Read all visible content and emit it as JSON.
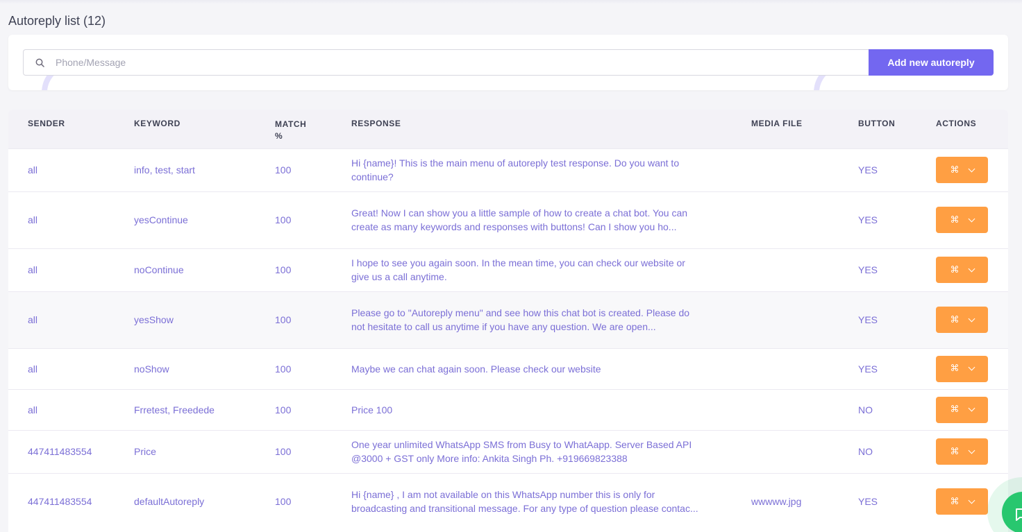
{
  "page": {
    "title": "Autoreply list (12)"
  },
  "search": {
    "placeholder": "Phone/Message",
    "value": "",
    "icon": "search-icon"
  },
  "toolbar": {
    "add_label": "Add new autoreply"
  },
  "table": {
    "headers": {
      "sender": "SENDER",
      "keyword": "KEYWORD",
      "match": "MATCH %",
      "response": "RESPONSE",
      "media": "MEDIA FILE",
      "button": "BUTTON",
      "actions": "ACTIONS"
    },
    "rows": [
      {
        "sender": "all",
        "keyword": "info, test, start",
        "match": "100",
        "response": "Hi {name}! This is the main menu of autoreply test response. Do you want to continue?",
        "media": "",
        "button": "YES"
      },
      {
        "sender": "all",
        "keyword": "yesContinue",
        "match": "100",
        "response": "Great! Now I can show you a little sample of how to create a chat bot. You can create as many keywords and responses with buttons! Can I show you ho...",
        "media": "",
        "button": "YES"
      },
      {
        "sender": "all",
        "keyword": "noContinue",
        "match": "100",
        "response": "I hope to see you again soon. In the mean time, you can check our website or give us a call anytime.",
        "media": "",
        "button": "YES"
      },
      {
        "sender": "all",
        "keyword": "yesShow",
        "match": "100",
        "response": "Please go to \"Autoreply menu\" and see how this chat bot is created. Please do not hesitate to call us anytime if you have any question. We are open...",
        "media": "",
        "button": "YES"
      },
      {
        "sender": "all",
        "keyword": "noShow",
        "match": "100",
        "response": "Maybe we can chat again soon. Please check our website",
        "media": "",
        "button": "YES"
      },
      {
        "sender": "all",
        "keyword": "Frretest, Freedede",
        "match": "100",
        "response": "Price 100",
        "media": "",
        "button": "NO"
      },
      {
        "sender": "447411483554",
        "keyword": "Price",
        "match": "100",
        "response": "One year unlimited WhatsApp SMS from Busy to WhatAapp. Server Based API @3000 + GST only More info: Ankita Singh Ph. +919669823388",
        "media": "",
        "button": "NO"
      },
      {
        "sender": "447411483554",
        "keyword": "defaultAutoreply",
        "match": "100",
        "response": "Hi {name} , I am not available on this WhatsApp number this is only for broadcasting and transitional message. For any type of question please contac...",
        "media": "wwwww.jpg",
        "button": "YES"
      }
    ]
  },
  "action_button": {
    "icon": "command-icon",
    "caret": "chevron-down-icon",
    "glyph": "⌘"
  },
  "colors": {
    "accent": "#7367f0",
    "action": "#ff9f43",
    "text": "#7b6fd6",
    "chat": "#28c76f"
  }
}
